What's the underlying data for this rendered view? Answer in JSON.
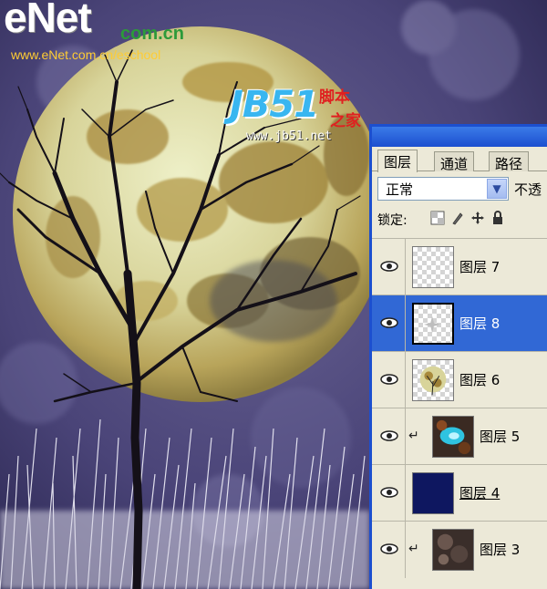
{
  "watermarks": {
    "enet_logo": "eNet",
    "enet_dot": "com.cn",
    "enet_url": "www.eNet.com.cn/eschool",
    "jb51_logo": "JB51",
    "jb51_cn_line1": "脚本",
    "jb51_cn_line2": "之家",
    "jb51_url": "www.jb51.net"
  },
  "layers_panel": {
    "tabs": [
      {
        "label": "图层",
        "active": true
      },
      {
        "label": "通道",
        "active": false
      },
      {
        "label": "路径",
        "active": false
      }
    ],
    "blend_mode": "正常",
    "opacity_label": "不透",
    "lock_label": "锁定:",
    "lock_icons": [
      "lock-transparent-icon",
      "lock-paint-icon",
      "lock-move-icon",
      "lock-all-icon"
    ],
    "layers": [
      {
        "name": "图层 7",
        "visible": true,
        "selected": false,
        "clipped": false,
        "thumb": "transparent"
      },
      {
        "name": "图层 8",
        "visible": true,
        "selected": true,
        "clipped": false,
        "thumb": "transparent-sparkle"
      },
      {
        "name": "图层 6",
        "visible": true,
        "selected": false,
        "clipped": false,
        "thumb": "moon"
      },
      {
        "name": "图层 5",
        "visible": true,
        "selected": false,
        "clipped": true,
        "thumb": "cyan-texture"
      },
      {
        "name": "图层 4",
        "visible": true,
        "selected": false,
        "clipped": false,
        "thumb": "navy-fill"
      },
      {
        "name": "图层 3",
        "visible": true,
        "selected": false,
        "clipped": true,
        "thumb": "dark-texture"
      }
    ],
    "colors": {
      "selection": "#3168d5",
      "panel_bg": "#ece9d8",
      "titlebar": "#1c4fcf"
    }
  }
}
